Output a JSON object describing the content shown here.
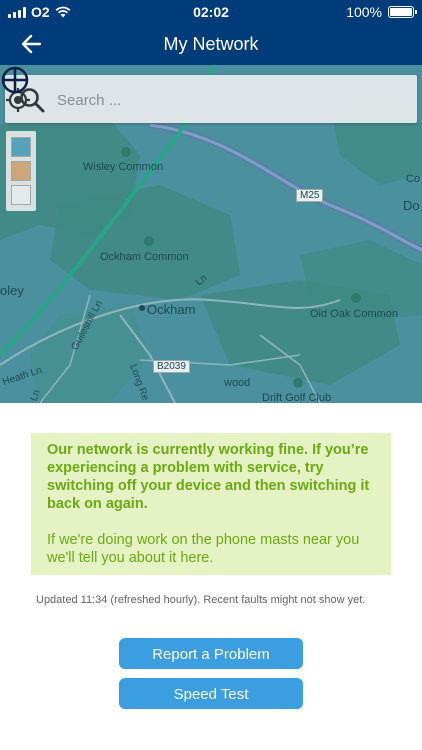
{
  "status_bar": {
    "carrier": "O2",
    "time": "02:02",
    "battery": "100%"
  },
  "header": {
    "title": "My Network",
    "back_icon": "back-arrow-icon"
  },
  "map": {
    "search_placeholder": "Search ...",
    "search_icon": "search-icon",
    "location_icon": "locate-me-icon",
    "labels": {
      "wisley_common": "Wisley Common",
      "ockham_common": "Ockham Common",
      "ockham": "Ockham",
      "oid_oak_common": "Oid Oak Common",
      "drift_golf_club": "Drift Golf Club",
      "m25": "M25",
      "b2039": "B2039",
      "guileshill_ln": "Guileshill Ln",
      "heath_ln": "Heath Ln",
      "long_re": "Long Re",
      "wood": "wood",
      "oley": "oley",
      "co": "Co",
      "do": "Do",
      "ln": "Ln",
      "ln2": "Ln"
    },
    "layer_colors": [
      "#5aa3c0",
      "#d9a97a",
      "#f2f2f2"
    ],
    "crosshair_icon": "crosshair-icon"
  },
  "notice": {
    "primary": "Our network is currently working fine. If you’re experiencing a problem with service, try switching off your device and then switching it back on again.",
    "secondary": "If we're doing work on the phone masts near you we'll tell you about it here."
  },
  "updated_text": "Updated 11:34 (refreshed hourly). Recent faults might not show yet.",
  "buttons": {
    "report": "Report a Problem",
    "speed": "Speed Test"
  },
  "colors": {
    "brand": "#003b7a",
    "button": "#3b9ee0",
    "notice_bg": "#e5f2c4",
    "notice_text": "#6aaa12"
  }
}
